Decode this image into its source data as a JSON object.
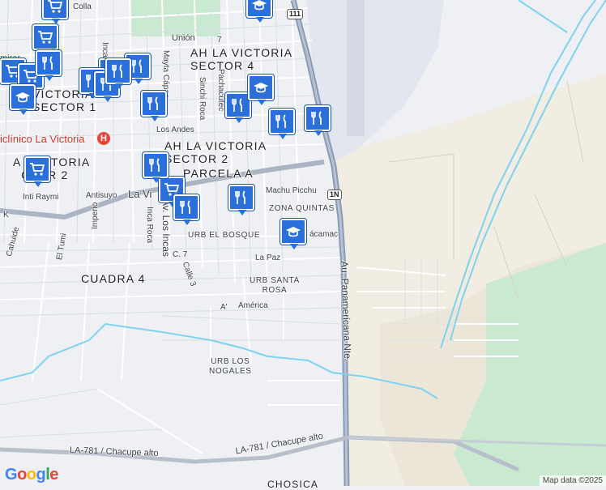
{
  "map": {
    "area_labels": [
      {
        "id": "ah-la-victoria-sector-4",
        "text": "AH LA VICTORIA\nSECTOR 4"
      },
      {
        "id": "ah-la-victoria-sector-2",
        "text": "AH LA VICTORIA\nSECTOR 2"
      },
      {
        "id": "parcela-a",
        "text": "PARCELA A"
      },
      {
        "id": "a-victoria-sector-2",
        "text": "A  VICTORIA\n  CTOR 2"
      },
      {
        "id": "victoria-sector-1",
        "text": "VICTORIA\nSECTOR 1"
      },
      {
        "id": "cuadra-4",
        "text": "CUADRA 4"
      }
    ],
    "small_area_labels": [
      {
        "id": "zona-quintas",
        "text": "ZONA QUINTAS"
      },
      {
        "id": "urb-el-bosque",
        "text": "URB EL BOSQUE"
      },
      {
        "id": "urb-santa-rosa",
        "text": "URB SANTA\nROSA"
      },
      {
        "id": "urb-los-nogales",
        "text": "URB LOS\nNOGALES"
      }
    ],
    "street_labels": [
      {
        "id": "colla",
        "text": "Colla"
      },
      {
        "id": "union",
        "text": "Unión"
      },
      {
        "id": "inca",
        "text": "Inca"
      },
      {
        "id": "mayta-capac",
        "text": "Mayta Cápac"
      },
      {
        "id": "pachacutec",
        "text": "Pachacútec"
      },
      {
        "id": "sinchi-roca",
        "text": "Sinchi Roca"
      },
      {
        "id": "los-andes",
        "text": "Los Andes"
      },
      {
        "id": "inti-raymi",
        "text": "Inti Raymi"
      },
      {
        "id": "antisuyo",
        "text": "Antisuyo"
      },
      {
        "id": "la-victoria-av",
        "text": "La Vi"
      },
      {
        "id": "machu-picchu",
        "text": "Machu Picchu"
      },
      {
        "id": "av-los-incas",
        "text": "Av. Los Incas"
      },
      {
        "id": "inca-roca",
        "text": "Inca Roca"
      },
      {
        "id": "imperio",
        "text": "Imperio"
      },
      {
        "id": "el-tumi",
        "text": "El Tumi"
      },
      {
        "id": "cahuide",
        "text": "Cahuide"
      },
      {
        "id": "k",
        "text": "K"
      },
      {
        "id": "c-7",
        "text": "C. 7"
      },
      {
        "id": "calle-3",
        "text": "Calle 3"
      },
      {
        "id": "la-paz",
        "text": "La Paz"
      },
      {
        "id": "camac",
        "text": "ácamac"
      },
      {
        "id": "america",
        "text": "América"
      },
      {
        "id": "a-apos",
        "text": "A'"
      },
      {
        "id": "panamericana",
        "text": "Au. Panamericana Nte."
      },
      {
        "id": "la-781-left",
        "text": "LA-781 / Chacupe alto"
      },
      {
        "id": "la-781-right",
        "text": "LA-781 / Chacupe alto"
      },
      {
        "id": "mirar",
        "text": "mirar"
      },
      {
        "id": "bottom-cut",
        "text": "CHOSICA"
      }
    ],
    "poi_labels": [
      {
        "id": "policlinico",
        "text": "iclínico La Victoria"
      }
    ],
    "route_shields": [
      {
        "id": "shield-111",
        "text": "111"
      },
      {
        "id": "shield-1n",
        "text": "1N"
      },
      {
        "id": "shield-7",
        "text": "7"
      }
    ],
    "markers": [
      {
        "type": "grocery"
      },
      {
        "type": "grocery"
      },
      {
        "type": "grocery"
      },
      {
        "type": "grocery"
      },
      {
        "type": "grocery"
      },
      {
        "type": "grocery"
      },
      {
        "type": "grocery"
      },
      {
        "type": "restaurant"
      },
      {
        "type": "restaurant"
      },
      {
        "type": "restaurant"
      },
      {
        "type": "restaurant"
      },
      {
        "type": "restaurant"
      },
      {
        "type": "restaurant"
      },
      {
        "type": "restaurant"
      },
      {
        "type": "restaurant"
      },
      {
        "type": "restaurant"
      },
      {
        "type": "restaurant"
      },
      {
        "type": "restaurant"
      },
      {
        "type": "restaurant"
      },
      {
        "type": "school"
      },
      {
        "type": "school"
      },
      {
        "type": "school"
      },
      {
        "type": "school"
      }
    ],
    "attribution": "Map data ©2025",
    "logo": "Google"
  },
  "colors": {
    "marker": "#2a70d8",
    "water": "#7fd3f0",
    "highway": "#8a9bb5",
    "park": "#c9e9d1",
    "land": "#f2ede2"
  }
}
